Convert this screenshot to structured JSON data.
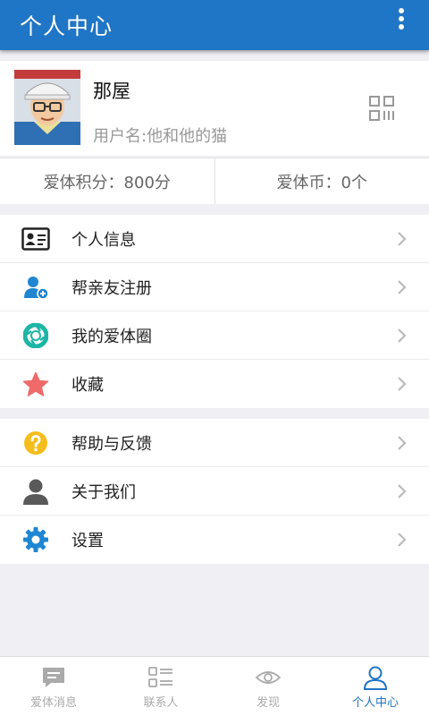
{
  "header": {
    "title": "个人中心",
    "more_icon": "more-vertical-icon"
  },
  "profile": {
    "name": "那屋",
    "username": "用户名:他和他的猫",
    "avatar_icon": "user-avatar-cartoon",
    "qr_icon": "qr-code-icon"
  },
  "stats": {
    "points": "爱体积分：800分",
    "coins": "爱体币：0个"
  },
  "menu_group1": [
    {
      "label": "个人信息",
      "icon": "id-card-icon",
      "color": "#222222"
    },
    {
      "label": "帮亲友注册",
      "icon": "add-user-icon",
      "color": "#1f86d1"
    },
    {
      "label": "我的爱体圈",
      "icon": "shutter-circle-icon",
      "color": "#1db5a5"
    },
    {
      "label": "收藏",
      "icon": "star-icon",
      "color": "#f06a6a"
    }
  ],
  "menu_group2": [
    {
      "label": "帮助与反馈",
      "icon": "help-icon",
      "color": "#f5bd1b"
    },
    {
      "label": "关于我们",
      "icon": "person-icon",
      "color": "#5a5a5a"
    },
    {
      "label": "设置",
      "icon": "gear-icon",
      "color": "#1f86d1"
    }
  ],
  "tabs": [
    {
      "label": "爱体消息",
      "icon": "message-icon",
      "active": false
    },
    {
      "label": "联系人",
      "icon": "contacts-list-icon",
      "active": false
    },
    {
      "label": "发现",
      "icon": "eye-icon",
      "active": false
    },
    {
      "label": "个人中心",
      "icon": "user-icon",
      "active": true
    }
  ],
  "colors": {
    "primary": "#1f75c6",
    "background": "#efeff4",
    "inactive": "#aaaaaa"
  }
}
